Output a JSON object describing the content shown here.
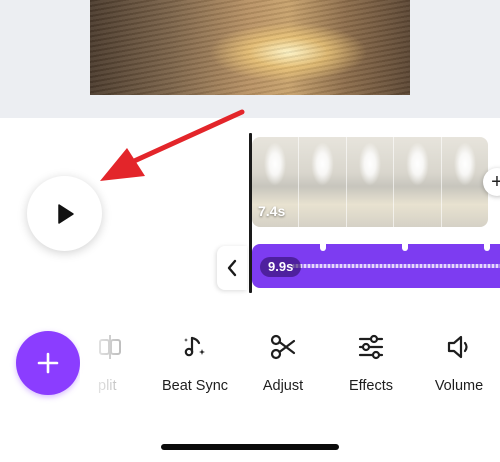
{
  "video_clip": {
    "duration": "7.4s"
  },
  "audio_track": {
    "duration": "9.9s",
    "color": "#7d3cf1"
  },
  "add_button": {
    "label": "+",
    "color": "#8b3dff"
  },
  "add_clip": {
    "label": "+"
  },
  "toolbar": {
    "items": [
      {
        "label": "plit",
        "icon": "split-icon"
      },
      {
        "label": "Beat Sync",
        "icon": "beat-sync-icon"
      },
      {
        "label": "Adjust",
        "icon": "scissors-icon"
      },
      {
        "label": "Effects",
        "icon": "sliders-icon"
      },
      {
        "label": "Volume",
        "icon": "speaker-icon"
      }
    ]
  },
  "annotation": {
    "color": "#e3252a"
  }
}
